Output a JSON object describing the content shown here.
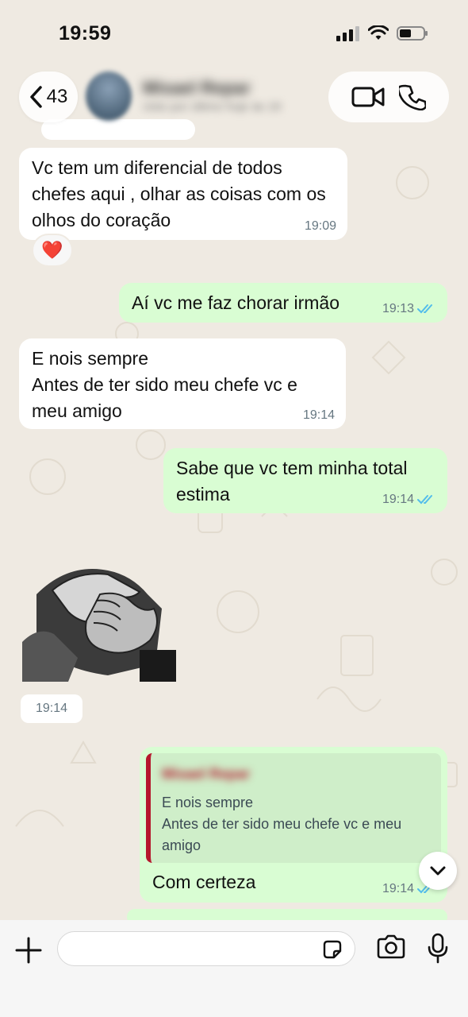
{
  "status_bar": {
    "time": "19:59"
  },
  "header": {
    "back_count": "43",
    "contact_name": "Misael Repar",
    "contact_subtitle": "visto por último hoje às 19"
  },
  "messages": [
    {
      "direction": "in",
      "text": "Vc tem um diferencial de todos chefes aqui , olhar as coisas com os olhos do coração",
      "time": "19:09",
      "reaction": "❤️"
    },
    {
      "direction": "out",
      "text": "Aí vc me faz chorar irmão",
      "time": "19:13",
      "read": true
    },
    {
      "direction": "in",
      "text": "E nois sempre\nAntes de ter sido meu chefe vc e meu amigo",
      "time": "19:14"
    },
    {
      "direction": "out",
      "text": "Sabe que vc tem minha total estima",
      "time": "19:14",
      "read": true
    },
    {
      "direction": "in",
      "type": "sticker",
      "sticker": "clasped-hands",
      "time": "19:14"
    },
    {
      "direction": "out",
      "quote_author": "Misael Repar",
      "quote_text": "E nois sempre\nAntes de ter sido meu chefe vc e meu amigo",
      "text": "Com certeza",
      "time": "19:14",
      "read": true
    }
  ],
  "composer": {
    "placeholder": ""
  },
  "colors": {
    "incoming": "#ffffff",
    "outgoing": "#d9fdd3",
    "read_ticks": "#53bdeb",
    "quote_bar": "#b5182d",
    "background": "#efeae2"
  }
}
